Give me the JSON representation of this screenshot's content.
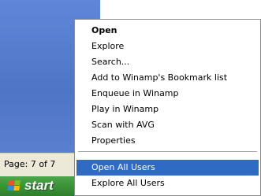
{
  "status_bar": {
    "page_text": "Page: 7 of 7"
  },
  "taskbar": {
    "start_label": "start",
    "right_fragment": "st",
    "logo_colors": [
      "#f3512b",
      "#7fbc1f",
      "#2b8ee8",
      "#fdbd08"
    ]
  },
  "context_menu": {
    "items": [
      {
        "label": "Open",
        "default": true
      },
      {
        "label": "Explore"
      },
      {
        "label": "Search..."
      },
      {
        "label": "Add to Winamp's Bookmark list"
      },
      {
        "label": "Enqueue in Winamp"
      },
      {
        "label": "Play in Winamp"
      },
      {
        "label": "Scan with AVG"
      },
      {
        "label": "Properties"
      },
      {
        "label": "Open All Users",
        "selected": true
      },
      {
        "label": "Explore All Users"
      }
    ]
  },
  "colors": {
    "selection": "#316ac5",
    "taskbar_blue": "#2456d6",
    "start_green": "#3c9538"
  }
}
